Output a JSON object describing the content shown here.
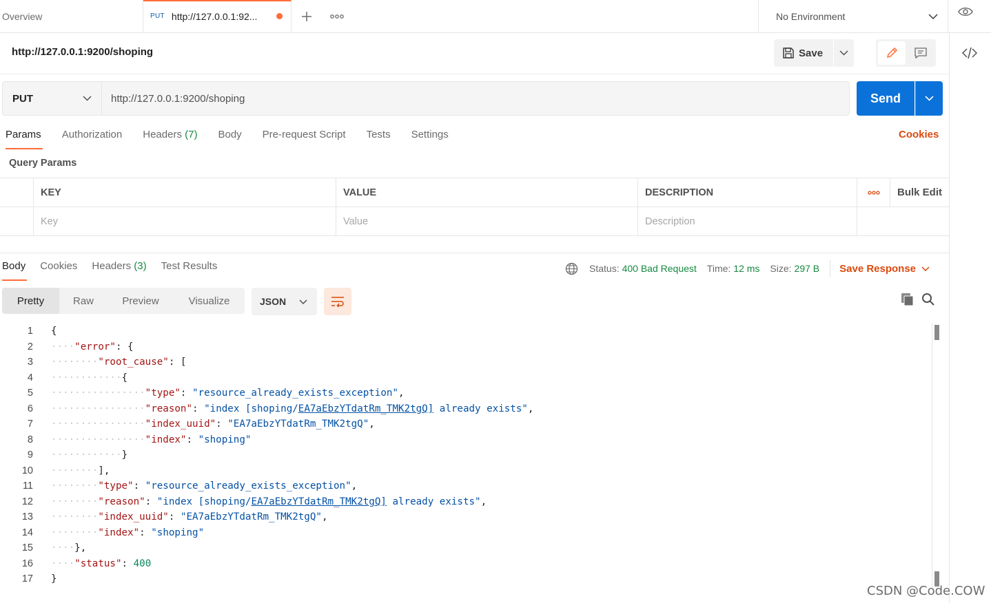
{
  "tabs": {
    "overview": "Overview",
    "active_method": "PUT",
    "active_url": "http://127.0.0.1:92...",
    "environment": "No Environment"
  },
  "request": {
    "title": "http://127.0.0.1:9200/shoping",
    "save_label": "Save",
    "method": "PUT",
    "url": "http://127.0.0.1:9200/shoping",
    "send_label": "Send"
  },
  "req_tabs": {
    "params": "Params",
    "authorization": "Authorization",
    "headers": "Headers",
    "headers_count": "(7)",
    "body": "Body",
    "prerequest": "Pre-request Script",
    "tests": "Tests",
    "settings": "Settings",
    "cookies": "Cookies"
  },
  "params": {
    "label": "Query Params",
    "col_key": "KEY",
    "col_value": "VALUE",
    "col_desc": "DESCRIPTION",
    "bulk_edit": "Bulk Edit",
    "ph_key": "Key",
    "ph_value": "Value",
    "ph_desc": "Description"
  },
  "response": {
    "tab_body": "Body",
    "tab_cookies": "Cookies",
    "tab_headers": "Headers",
    "headers_count": "(3)",
    "tab_tests": "Test Results",
    "status_label": "Status:",
    "status_value": "400 Bad Request",
    "time_label": "Time:",
    "time_value": "12 ms",
    "size_label": "Size:",
    "size_value": "297 B",
    "save_response": "Save Response",
    "views": [
      "Pretty",
      "Raw",
      "Preview",
      "Visualize"
    ],
    "format": "JSON"
  },
  "code_lines": [
    "{",
    "\"error\": {",
    "\"root_cause\": [",
    "{",
    "\"type\": \"resource_already_exists_exception\",",
    "\"reason\": \"index [shoping/EA7aEbzYTdatRm_TMK2tgQ] already exists\",",
    "\"index_uuid\": \"EA7aEbzYTdatRm_TMK2tgQ\",",
    "\"index\": \"shoping\"",
    "}",
    "],",
    "\"type\": \"resource_already_exists_exception\",",
    "\"reason\": \"index [shoping/EA7aEbzYTdatRm_TMK2tgQ] already exists\",",
    "\"index_uuid\": \"EA7aEbzYTdatRm_TMK2tgQ\",",
    "\"index\": \"shoping\"",
    "},",
    "\"status\": 400",
    "}"
  ],
  "code_indent": [
    0,
    1,
    2,
    3,
    4,
    4,
    4,
    4,
    3,
    2,
    2,
    2,
    2,
    2,
    1,
    1,
    0
  ],
  "watermark": "CSDN @Code.COW",
  "colors": {
    "accent": "#ff6c37",
    "send": "#0b72d9",
    "status_ok": "#168a40"
  }
}
